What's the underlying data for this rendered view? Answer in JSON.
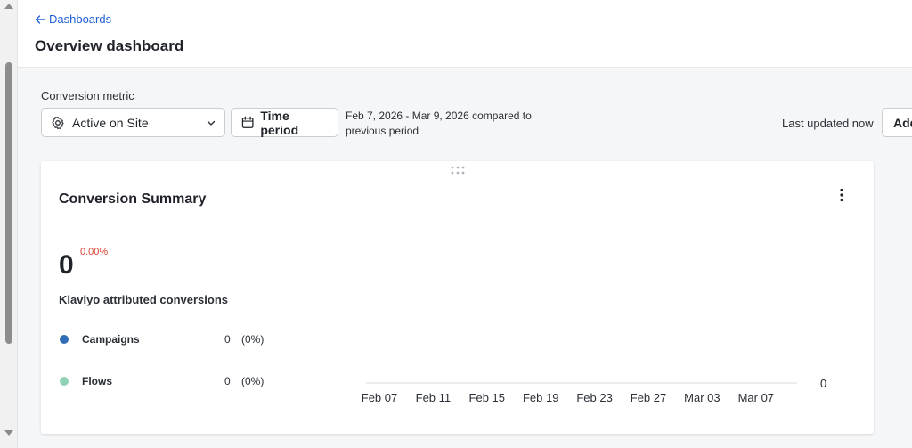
{
  "nav": {
    "back_label": "Dashboards"
  },
  "page": {
    "title": "Overview dashboard"
  },
  "controls": {
    "metric_label": "Conversion metric",
    "metric_value": "Active on Site",
    "time_button": "Time period",
    "date_range": "Feb 7, 2026 - Mar 9, 2026 compared to previous period",
    "last_updated": "Last updated now",
    "add_button": "Add"
  },
  "card": {
    "title": "Conversion Summary",
    "value": "0",
    "change": "0.00%",
    "subtitle": "Klaviyo attributed conversions",
    "legend": [
      {
        "name": "Campaigns",
        "count": "0",
        "pct": "(0%)",
        "color": "#2f6db5"
      },
      {
        "name": "Flows",
        "count": "0",
        "pct": "(0%)",
        "color": "#8fd3b6"
      }
    ]
  },
  "chart_data": {
    "type": "line",
    "x": [
      "Feb 07",
      "Feb 11",
      "Feb 15",
      "Feb 19",
      "Feb 23",
      "Feb 27",
      "Mar 03",
      "Mar 07"
    ],
    "series": [
      {
        "values": [
          0,
          0,
          0,
          0,
          0,
          0,
          0,
          0
        ]
      }
    ],
    "y_tick_labels": [
      "0"
    ],
    "ylim": [
      0,
      1
    ],
    "grid": false
  },
  "colors": {
    "accent": "#1f5fd6",
    "negative": "#d9412e",
    "campaigns": "#2f6db5",
    "flows": "#8fd3b6"
  }
}
